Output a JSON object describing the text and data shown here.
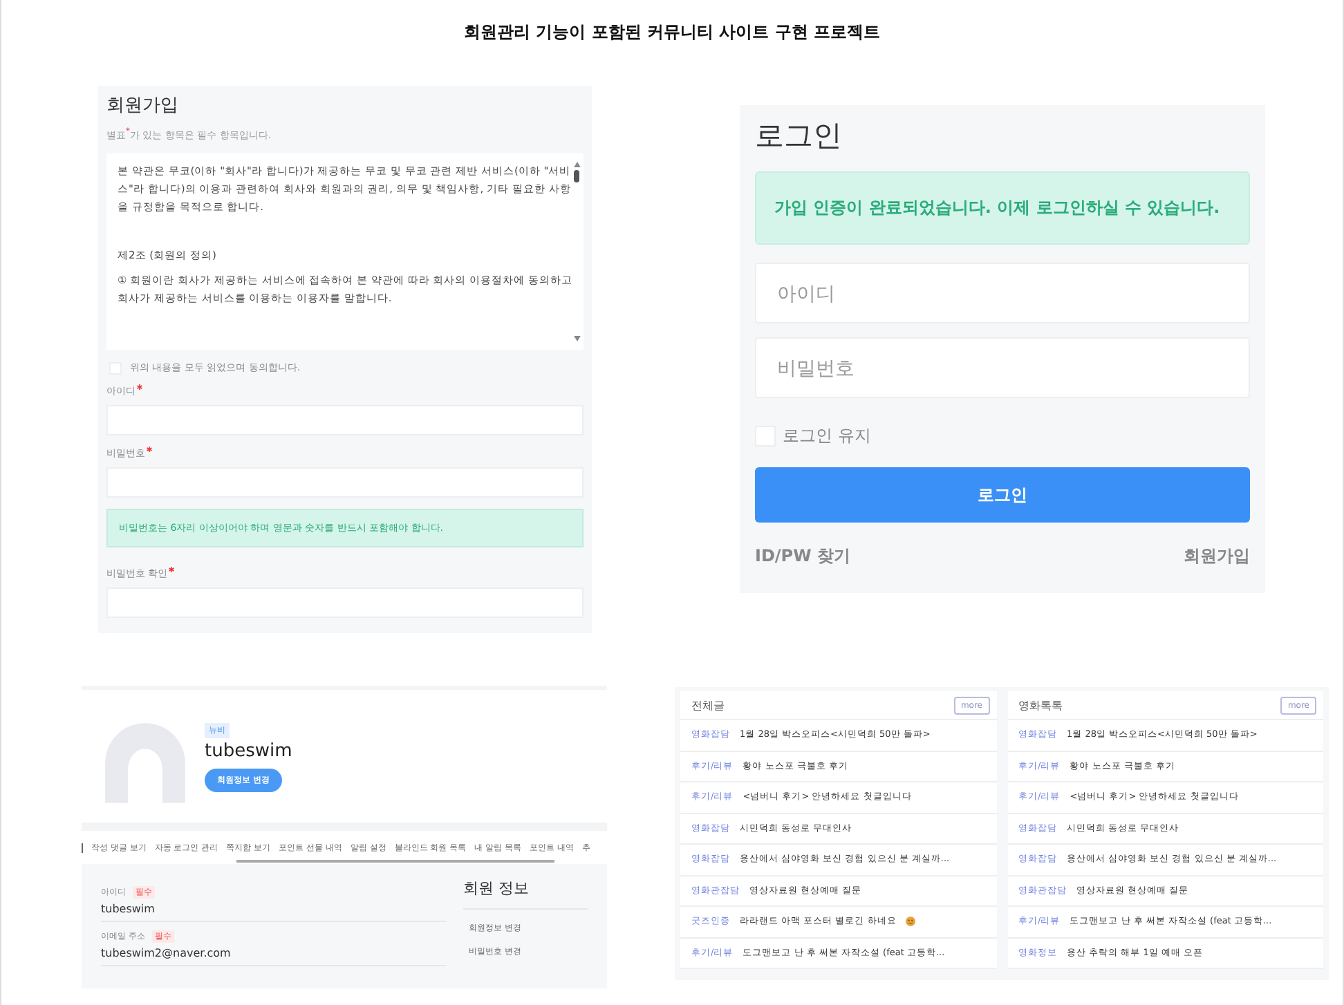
{
  "page_title": "회원관리 기능이 포함된 커뮤니티 사이트 구현 프로젝트",
  "signup": {
    "title": "회원가입",
    "note": "별표$^{*}$가 있는 항목은 필수 항목입니다.",
    "terms": [
      "본 약관은 무코(이하 \"회사\"라 합니다)가 제공하는 무코 및 무코 관련 제반 서비스(이하 \"서비스\"라 합니다)의 이용과 관련하여 회사와 회원과의 권리, 의무 및 책임사항, 기타 필요한 사항을 규정함을 목적으로 합니다.",
      "제2조 (회원의 정의)",
      "① 회원이란 회사가 제공하는 서비스에 접속하여 본 약관에 따라 회사의 이용절차에 동의하고 회사가 제공하는 서비스를 이용하는 이용자를 말합니다."
    ],
    "agree": {
      "label": "위의 내용을 모두 읽었으며 동의합니다.",
      "checked": false
    },
    "fields": [
      {
        "kind": "input",
        "label": "아이디",
        "required": true
      },
      {
        "kind": "input",
        "label": "비밀번호",
        "required": true
      },
      {
        "kind": "alert",
        "text": "비밀번호는 6자리 이상이어야 하며 영문과 숫자를 반드시 포함해야 합니다."
      },
      {
        "kind": "input",
        "label": "비밀번호 확인",
        "required": true
      }
    ]
  },
  "login": {
    "title": "로그인",
    "alert": "가입 인증이 완료되었습니다. 이제 로그인하실 수 있습니다.",
    "id_placeholder": "아이디",
    "pw_placeholder": "비밀번호",
    "remember": {
      "label": "로그인 유지",
      "checked": false
    },
    "button": "로그인",
    "find_link": "ID/PW 찾기",
    "signup_link": "회원가입"
  },
  "profile": {
    "badge": "뉴비",
    "name": "tubeswim",
    "edit_button": "회원정보 변경",
    "tabs": [
      "작성 댓글 보기",
      "자동 로그인 관리",
      "쪽지함 보기",
      "포인트 선물 내역",
      "알림 설정",
      "블라인드 회원 목록",
      "내 알림 목록",
      "포인트 내역",
      "추"
    ],
    "fields": [
      {
        "label": "아이디",
        "badge": "필수",
        "value": "tubeswim"
      },
      {
        "label": "이메일 주소",
        "badge": "필수",
        "value": "tubeswim2@naver.com"
      }
    ],
    "side_title": "회원 정보",
    "side_links": [
      "회원정보 변경",
      "비밀번호 변경"
    ]
  },
  "boards": [
    {
      "title": "전체글",
      "more": "more",
      "rows": [
        {
          "category": "영화잡담",
          "title": "1월 28일 박스오피스<시민덕희 50만 돌파>",
          "emoji": false
        },
        {
          "category": "후기/리뷰",
          "title": "황야 노스포 극불호 후기",
          "emoji": false
        },
        {
          "category": "후기/리뷰",
          "title": "<넘버니 후기> 안녕하세요 첫글입니다",
          "emoji": false
        },
        {
          "category": "영화잡담",
          "title": "시민덕희 동성로 무대인사",
          "emoji": false
        },
        {
          "category": "영화잡담",
          "title": "용산에서 심야영화 보신 경험 있으신 분 계실까...",
          "emoji": false
        },
        {
          "category": "영화관잡담",
          "title": "영상자료원 현상예매 질문",
          "emoji": false
        },
        {
          "category": "굿즈인증",
          "title": "라라랜드 아맥 포스터 별로긴 하네요",
          "emoji": true
        },
        {
          "category": "후기/리뷰",
          "title": "도그맨보고 난 후 써본 자작소설 (feat 고등학...",
          "emoji": false
        }
      ]
    },
    {
      "title": "영화톡톡",
      "more": "more",
      "rows": [
        {
          "category": "영화잡담",
          "title": "1월 28일 박스오피스<시민덕희 50만 돌파>",
          "emoji": false
        },
        {
          "category": "후기/리뷰",
          "title": "황야 노스포 극불호 후기",
          "emoji": false
        },
        {
          "category": "후기/리뷰",
          "title": "<넘버니 후기> 안녕하세요 첫글입니다",
          "emoji": false
        },
        {
          "category": "영화잡담",
          "title": "시민덕희 동성로 무대인사",
          "emoji": false
        },
        {
          "category": "영화잡담",
          "title": "용산에서 심야영화 보신 경험 있으신 분 계실까...",
          "emoji": false
        },
        {
          "category": "영화관잡담",
          "title": "영상자료원 현상예매 질문",
          "emoji": false
        },
        {
          "category": "후기/리뷰",
          "title": "도그맨보고 난 후 써본 자작소설 (feat 고등학...",
          "emoji": false
        },
        {
          "category": "영화정보",
          "title": "용산 추락의 해부 1일 예매 오픈",
          "emoji": false
        }
      ]
    }
  ]
}
